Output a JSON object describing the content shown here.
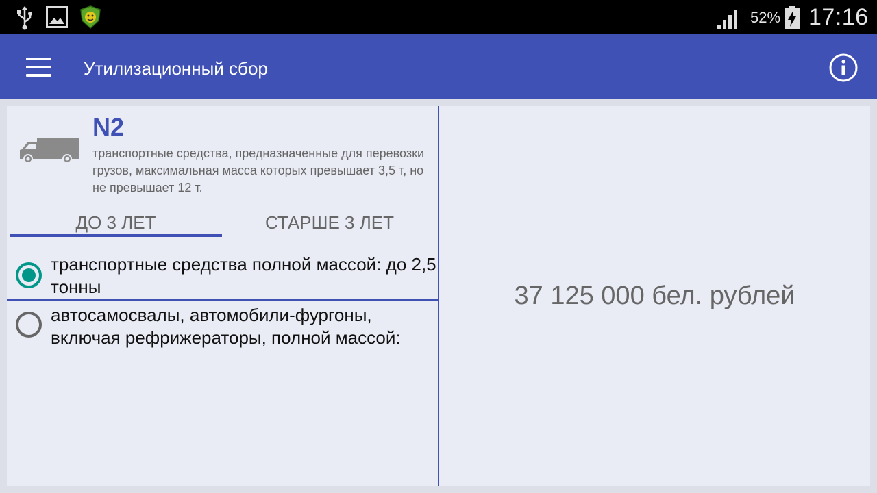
{
  "status_bar": {
    "battery_percent": "52%",
    "time": "17:16",
    "icons": [
      "usb-icon",
      "gallery-icon",
      "app-shield-icon",
      "signal-icon",
      "battery-charging-icon"
    ]
  },
  "app_bar": {
    "title": "Утилизационный сбор",
    "menu_icon": "hamburger-menu-icon",
    "info_icon": "info-icon"
  },
  "category": {
    "code": "N2",
    "icon": "truck-icon",
    "description": "транспортные средства, предназначенные для перевозки грузов, максимальная масса которых превышает 3,5 т, но не превышает 12 т."
  },
  "tabs": [
    {
      "label": "ДО 3 ЛЕТ",
      "selected": true
    },
    {
      "label": "СТАРШЕ 3 ЛЕТ",
      "selected": false
    }
  ],
  "options": [
    {
      "label": "транспортные средства полной массой: до 2,5 тонны",
      "selected": true
    },
    {
      "label": "автосамосвалы, автомобили-фургоны, включая рефрижераторы, полной массой:",
      "selected": false
    }
  ],
  "result": {
    "amount": "37 125 000 бел. рублей"
  },
  "colors": {
    "primary": "#3f51b5",
    "radio_selected": "#009688",
    "background": "#e9ebf5"
  }
}
